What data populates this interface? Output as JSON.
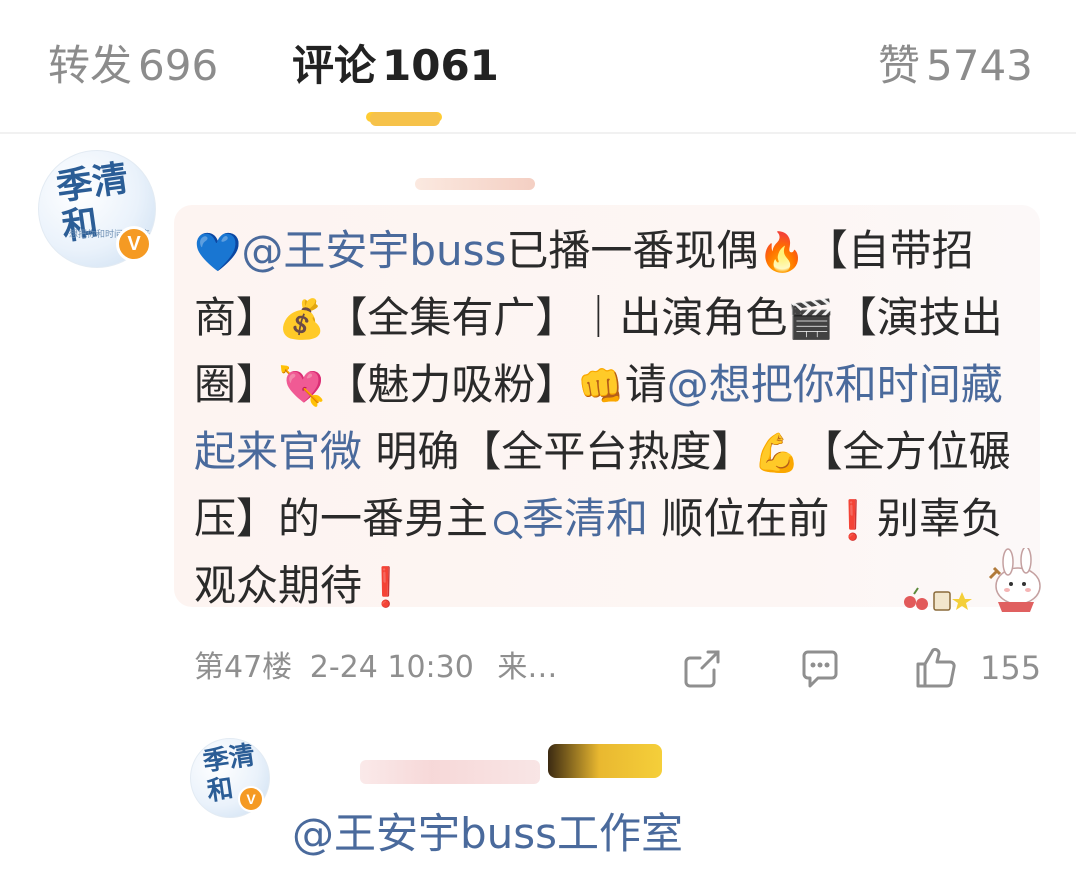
{
  "tabs": {
    "repost": {
      "label": "转发",
      "count": "696"
    },
    "comments": {
      "label": "评论",
      "count": "1061"
    },
    "likes": {
      "label": "赞",
      "count": "5743"
    }
  },
  "comment": {
    "avatar_text": "季清和",
    "avatar_subtext": "想把你和时间藏起来",
    "verified_badge": "V",
    "content": {
      "mention_1": "@王安宇buss",
      "text_1": "已播一番现偶",
      "text_2": "【自带招商】",
      "text_3": "【全集有广】｜出演角色",
      "text_4": "【演技出圈】",
      "text_5": "【魅力吸粉】",
      "text_6": "请",
      "mention_2": "@想把你和时间藏起来官微",
      "text_7": " 明确【全平台热度】",
      "text_8": "【全方位碾压】的一番男主",
      "search_link": "季清和",
      "text_9": " 顺位在前",
      "text_10": "别辜负观众期待"
    },
    "emojis": {
      "heart": "💙",
      "fire": "🔥",
      "money_bag": "💰",
      "clapper": "🎬",
      "cupid": "💘",
      "fist": "👊",
      "arm": "💪",
      "exclamation": "❗"
    },
    "meta": {
      "floor": "第47楼",
      "time": "2-24 10:30",
      "source": "来…"
    },
    "like_count": "155"
  },
  "sub_reply": {
    "avatar_text": "季清和",
    "text": "@王安宇buss工作室"
  },
  "icons": [
    "share-icon",
    "comment-icon",
    "thumbs-up-icon",
    "search-icon"
  ],
  "colors": {
    "link": "#4a6a9c",
    "accent": "#ffcc33",
    "bubble": "#fdf4f1",
    "badge": "#f59a23"
  }
}
